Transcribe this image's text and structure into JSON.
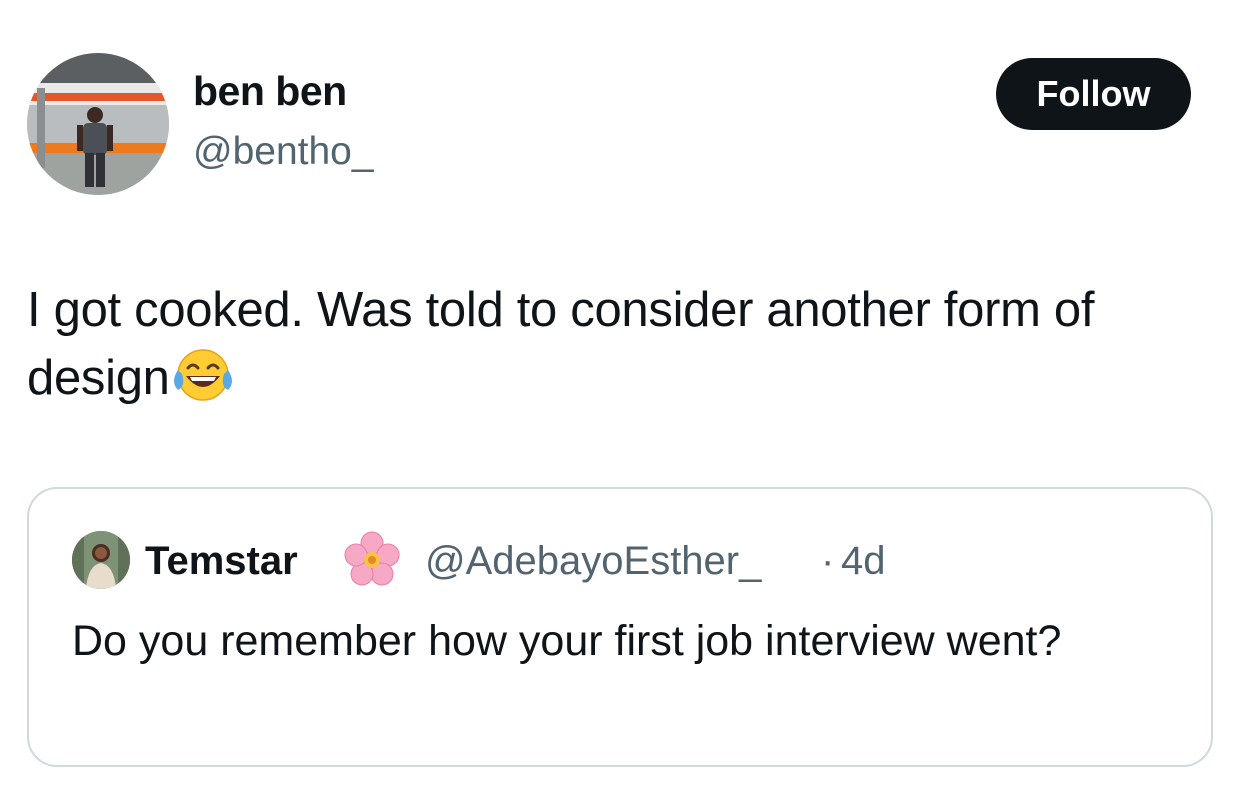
{
  "author": {
    "display_name": "ben ben",
    "handle": "@bentho_",
    "avatar_icon": "profile-photo"
  },
  "follow_button": {
    "label": "Follow"
  },
  "tweet": {
    "text": "I got cooked. Was told to consider another form of design",
    "emoji": "face-with-tears-of-joy-icon"
  },
  "quoted_tweet": {
    "display_name": "Temstar",
    "name_emoji": "cherry-blossom-icon",
    "handle": "@AdebayoEsther_",
    "separator": "·",
    "time": "4d",
    "text": "Do you remember how your first job interview went?"
  },
  "colors": {
    "text_primary": "#0f1419",
    "text_secondary": "#536471",
    "follow_bg": "#0f1419",
    "border": "#cfd9de"
  }
}
